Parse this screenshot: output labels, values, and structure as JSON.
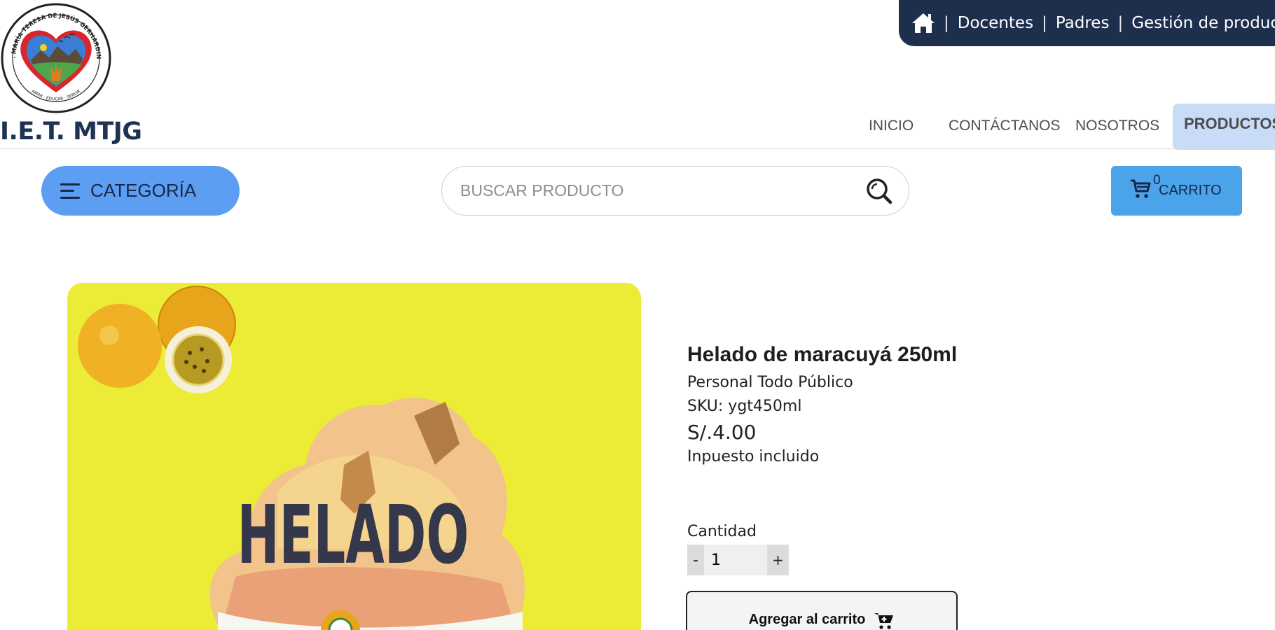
{
  "header": {
    "top_links": [
      "Docentes",
      "Padres",
      "Gestión de productos"
    ],
    "separator": "|",
    "brand": "I.E.T. MTJG",
    "logo_text": "I.E.T. MARÍA TERESA DE JESÚS GERHARDINGER",
    "logo_motto": "AMAR · EDUCAR · SERVIR"
  },
  "nav": {
    "inicio": "INICIO",
    "contacto": "CONTÁCTANOS",
    "nosotros": "NOSOTROS",
    "productos": "PRODUCTOS"
  },
  "toolbar": {
    "category_label": "CATEGORÍA",
    "search_placeholder": "BUSCAR PRODUCTO",
    "cart_count": "0",
    "cart_label": "CARRITO"
  },
  "product": {
    "image_text": "HELADO",
    "title": "Helado de maracuyá 250ml",
    "subtitle": "Personal Todo Público",
    "sku": "SKU: ygt450ml",
    "price": "S/.4.00",
    "tax_note": "Inpuesto incluido",
    "quantity_label": "Cantidad",
    "quantity_value": "1",
    "minus": "-",
    "plus": "+",
    "add_to_cart": "Agregar al carrito"
  },
  "colors": {
    "topbar": "#1e2f4d",
    "brand": "#1e3254",
    "category_button": "#5c9ef2",
    "cart_button": "#4ba3ea",
    "active_nav": "#c8dcf8",
    "product_bg": "#ecec36"
  },
  "icons": {
    "home": "home-icon",
    "menu": "menu-icon",
    "search": "search-icon",
    "cart": "cart-icon",
    "add_cart": "cart-plus-icon"
  }
}
